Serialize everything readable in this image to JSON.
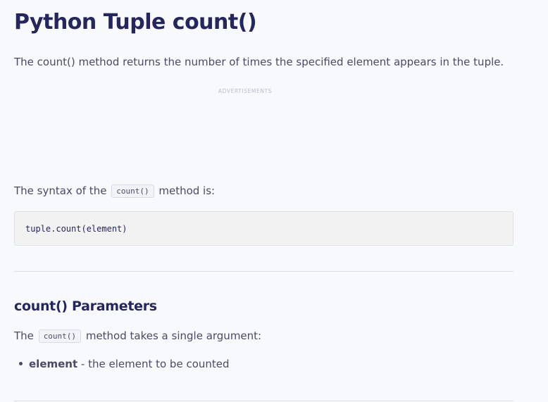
{
  "article": {
    "title": "Python Tuple count()",
    "intro": "The count() method returns the number of times the specified element appears in the tuple.",
    "ad_label": "ADVERTISEMENTS",
    "syntax": {
      "text_before": "The syntax of the",
      "code": "count()",
      "text_after": "method is:",
      "code_block": "tuple.count(element)"
    },
    "parameters": {
      "heading": "count() Parameters",
      "text_before": "The",
      "code": "count()",
      "text_after": "method takes a single argument:",
      "items": [
        {
          "term": "element",
          "description": "- the element to be counted"
        }
      ]
    }
  }
}
